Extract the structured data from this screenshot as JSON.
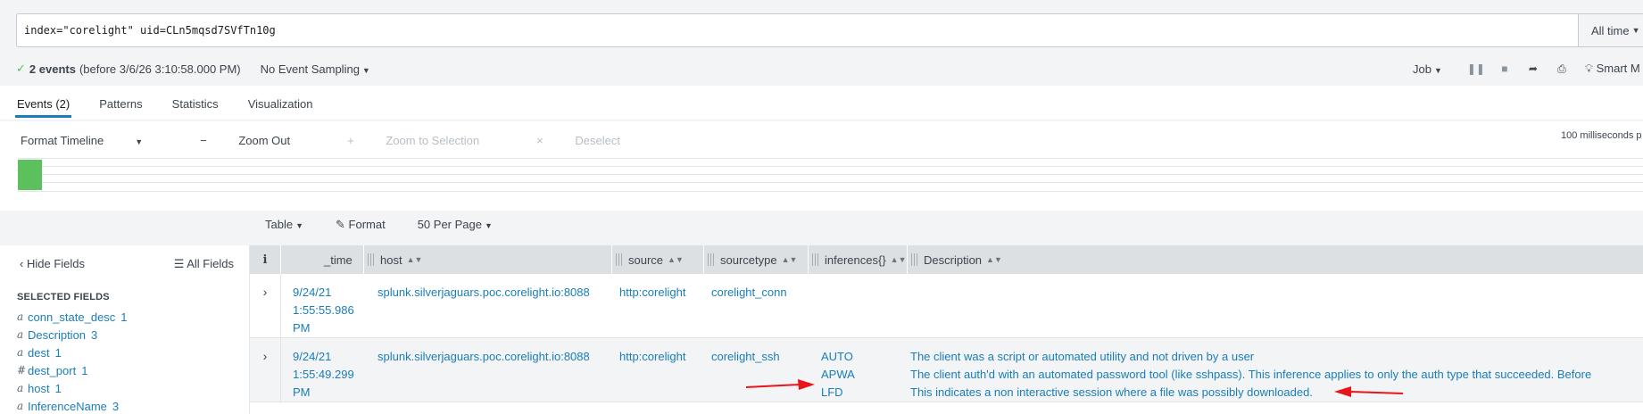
{
  "search": {
    "query": "index=\"corelight\" uid=CLn5mqsd7SVfTn10g",
    "time_range": "All time"
  },
  "status": {
    "events_count": "2 events",
    "events_before": "(before 3/6/26 3:10:58.000 PM)",
    "sampling": "No Event Sampling",
    "job": "Job",
    "smart_mode": "Smart M"
  },
  "tabs": [
    {
      "label": "Events (2)",
      "active": true
    },
    {
      "label": "Patterns",
      "active": false
    },
    {
      "label": "Statistics",
      "active": false
    },
    {
      "label": "Visualization",
      "active": false
    }
  ],
  "timeline": {
    "format_timeline": "Format Timeline",
    "zoom_out": "Zoom Out",
    "zoom_selection": "Zoom to Selection",
    "deselect": "Deselect",
    "scale": "100 milliseconds p"
  },
  "results_toolbar": {
    "table": "Table",
    "format": "Format",
    "per_page": "50 Per Page"
  },
  "sidebar": {
    "hide_fields": "Hide Fields",
    "all_fields": "All Fields",
    "selected_title": "SELECTED FIELDS",
    "fields": [
      {
        "type": "a",
        "name": "conn_state_desc",
        "count": "1"
      },
      {
        "type": "a",
        "name": "Description",
        "count": "3"
      },
      {
        "type": "a",
        "name": "dest",
        "count": "1"
      },
      {
        "type": "#",
        "name": "dest_port",
        "count": "1"
      },
      {
        "type": "a",
        "name": "host",
        "count": "1"
      },
      {
        "type": "a",
        "name": "InferenceName",
        "count": "3"
      }
    ]
  },
  "table": {
    "headers": {
      "info": "i",
      "time": "_time",
      "host": "host",
      "source": "source",
      "sourcetype": "sourcetype",
      "inferences": "inferences{}",
      "description": "Description"
    },
    "rows": [
      {
        "time": [
          "9/24/21",
          "1:55:55.986",
          "PM"
        ],
        "host": "splunk.silverjaguars.poc.corelight.io:8088",
        "source": "http:corelight",
        "sourcetype": "corelight_conn",
        "inferences": [],
        "descriptions": []
      },
      {
        "time": [
          "9/24/21",
          "1:55:49.299",
          "PM"
        ],
        "host": "splunk.silverjaguars.poc.corelight.io:8088",
        "source": "http:corelight",
        "sourcetype": "corelight_ssh",
        "inferences": [
          "AUTO",
          "APWA",
          "LFD"
        ],
        "descriptions": [
          "The client was a script or automated utility and not driven by a user",
          "The client auth'd with an automated password tool (like sshpass). This inference applies to only the auth type that succeeded. Before",
          "This indicates a non interactive session where a file was possibly downloaded."
        ]
      }
    ]
  },
  "colors": {
    "link": "#1a7db8",
    "accent": "#5cc05c",
    "annotation": "#e8141b"
  }
}
